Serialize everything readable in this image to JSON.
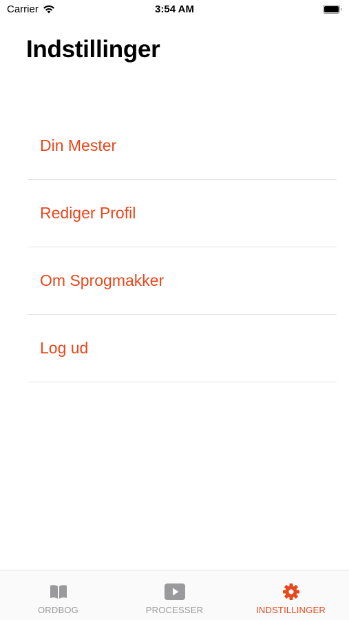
{
  "status_bar": {
    "carrier": "Carrier",
    "time": "3:54 AM",
    "wifi_icon": "wifi-icon",
    "battery_icon": "battery-icon"
  },
  "header": {
    "title": "Indstillinger"
  },
  "settings": {
    "items": [
      {
        "label": "Din Mester"
      },
      {
        "label": "Rediger Profil"
      },
      {
        "label": "Om Sprogmakker"
      },
      {
        "label": "Log ud"
      }
    ]
  },
  "tab_bar": {
    "tabs": [
      {
        "label": "ORDBOG",
        "icon": "book-icon",
        "active": false
      },
      {
        "label": "PROCESSER",
        "icon": "play-icon",
        "active": false
      },
      {
        "label": "INDSTILLINGER",
        "icon": "gear-icon",
        "active": true
      }
    ]
  },
  "colors": {
    "accent": "#e8471c",
    "inactive": "#9a9a9c",
    "separator": "#e3e3e6"
  }
}
